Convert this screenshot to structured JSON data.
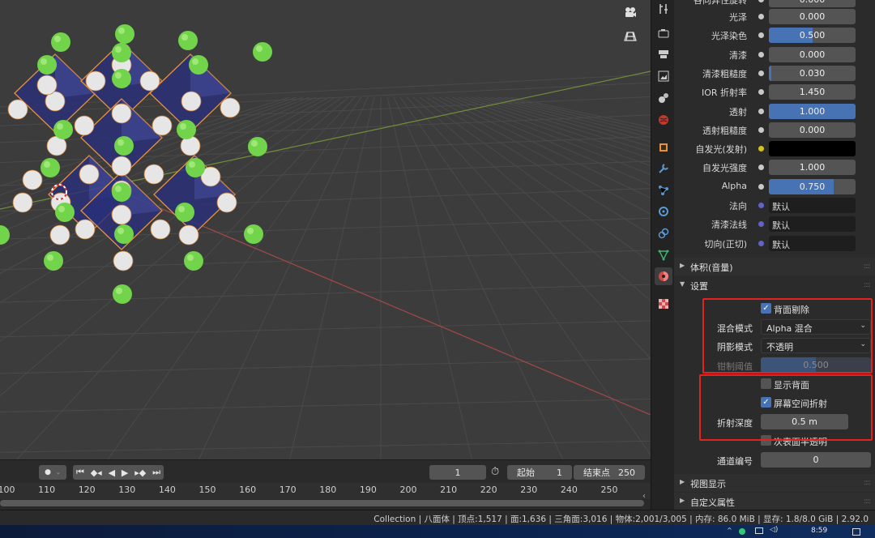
{
  "viewport": {
    "camera_icon": "camera-icon",
    "grid_icon": "ortho-grid-icon"
  },
  "properties": {
    "partial_row": {
      "label": "各向异性旋转"
    },
    "rows": [
      {
        "label": "光泽",
        "value": "0.000",
        "fill": 0.0
      },
      {
        "label": "光泽染色",
        "value": "0.500",
        "fill": 0.5
      },
      {
        "label": "清漆",
        "value": "0.000",
        "fill": 0.0
      },
      {
        "label": "清漆粗糙度",
        "value": "0.030",
        "fill": 0.03
      },
      {
        "label": "IOR 折射率",
        "value": "1.450",
        "fill": 0.0
      },
      {
        "label": "透射",
        "value": "1.000",
        "fill": 1.0
      },
      {
        "label": "透射粗糙度",
        "value": "0.000",
        "fill": 0.0
      },
      {
        "label": "自发光(发射)",
        "value": "",
        "color": "#000000"
      },
      {
        "label": "自发光强度",
        "value": "1.000",
        "fill": 0.0
      },
      {
        "label": "Alpha",
        "value": "0.750",
        "fill": 0.75
      }
    ],
    "link_rows": [
      {
        "label": "法向",
        "value": "默认"
      },
      {
        "label": "清漆法线",
        "value": "默认"
      },
      {
        "label": "切向(正切)",
        "value": "默认"
      }
    ],
    "panels": {
      "volume": "体积(音量)",
      "settings": "设置",
      "viewport_display": "视图显示",
      "custom_props": "自定义属性"
    },
    "settings": {
      "backface_culling": "背面剔除",
      "blend_mode_label": "混合模式",
      "blend_mode_value": "Alpha 混合",
      "shadow_mode_label": "阴影模式",
      "shadow_mode_value": "不透明",
      "clip_threshold_label": "钳制阈值",
      "clip_threshold_value": "0.500",
      "show_backface": "显示背面",
      "screen_space_refraction": "屏幕空间折射",
      "refraction_depth_label": "折射深度",
      "refraction_depth_value": "0.5 m",
      "subsurface_translucency": "次表面半透明",
      "pass_index_label": "通道编号",
      "pass_index_value": "0"
    }
  },
  "timeline": {
    "current_frame": "1",
    "start_label": "起始",
    "start_value": "1",
    "end_label": "结束点",
    "end_value": "250",
    "ruler": [
      "100",
      "110",
      "120",
      "130",
      "140",
      "150",
      "160",
      "170",
      "180",
      "190",
      "200",
      "210",
      "220",
      "230",
      "240",
      "250"
    ]
  },
  "statusbar": {
    "text": "Collection | 八面体 | 顶点:1,517 | 面:1,636 | 三角面:3,016 | 物体:2,001/3,005 | 内存: 86.0 MiB | 显存: 1.8/8.0 GiB | 2.92.0"
  },
  "taskbar": {
    "time": "8:59"
  },
  "colors": {
    "accent": "#4772b3",
    "highlight_box": "#e3231f",
    "sphere_green": "#72d44a",
    "sphere_white": "#e6e6e6",
    "octahedron_fill": "#2a2f7a",
    "octahedron_edge": "#e8913a"
  }
}
